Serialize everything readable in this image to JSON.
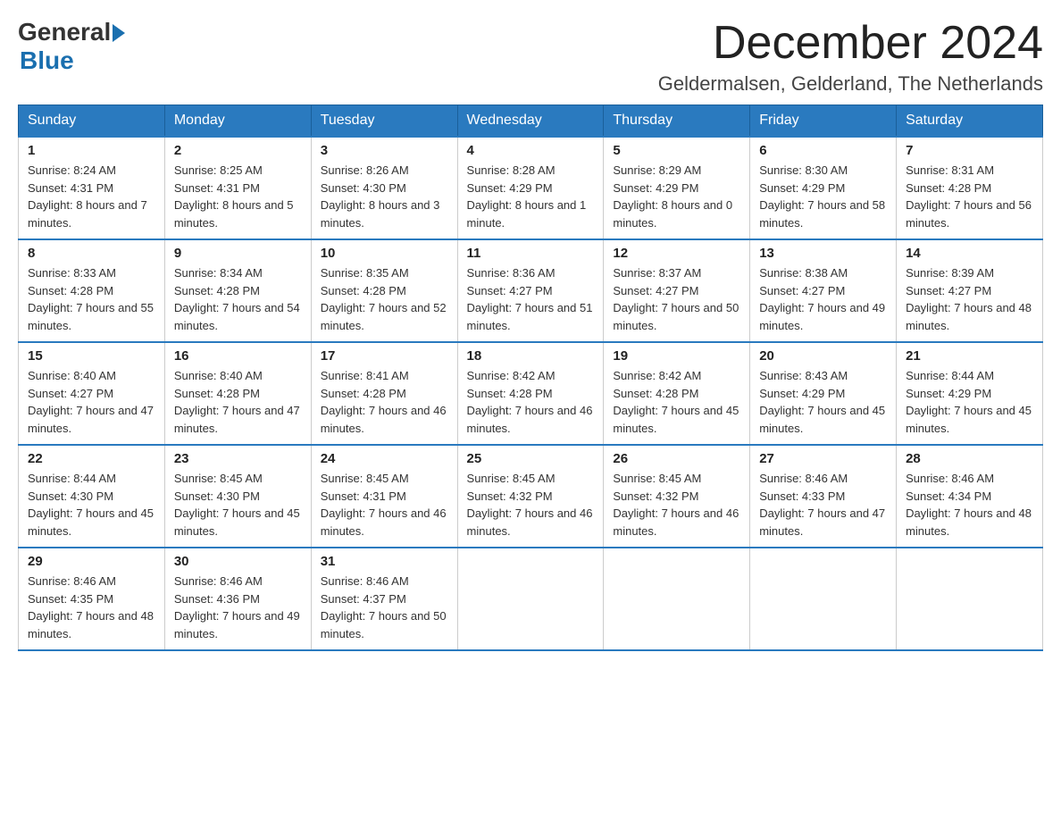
{
  "header": {
    "logo_general": "General",
    "logo_blue": "Blue",
    "month_title": "December 2024",
    "location": "Geldermalsen, Gelderland, The Netherlands"
  },
  "days_of_week": [
    "Sunday",
    "Monday",
    "Tuesday",
    "Wednesday",
    "Thursday",
    "Friday",
    "Saturday"
  ],
  "weeks": [
    [
      {
        "day": "1",
        "sunrise": "8:24 AM",
        "sunset": "4:31 PM",
        "daylight": "8 hours and 7 minutes."
      },
      {
        "day": "2",
        "sunrise": "8:25 AM",
        "sunset": "4:31 PM",
        "daylight": "8 hours and 5 minutes."
      },
      {
        "day": "3",
        "sunrise": "8:26 AM",
        "sunset": "4:30 PM",
        "daylight": "8 hours and 3 minutes."
      },
      {
        "day": "4",
        "sunrise": "8:28 AM",
        "sunset": "4:29 PM",
        "daylight": "8 hours and 1 minute."
      },
      {
        "day": "5",
        "sunrise": "8:29 AM",
        "sunset": "4:29 PM",
        "daylight": "8 hours and 0 minutes."
      },
      {
        "day": "6",
        "sunrise": "8:30 AM",
        "sunset": "4:29 PM",
        "daylight": "7 hours and 58 minutes."
      },
      {
        "day": "7",
        "sunrise": "8:31 AM",
        "sunset": "4:28 PM",
        "daylight": "7 hours and 56 minutes."
      }
    ],
    [
      {
        "day": "8",
        "sunrise": "8:33 AM",
        "sunset": "4:28 PM",
        "daylight": "7 hours and 55 minutes."
      },
      {
        "day": "9",
        "sunrise": "8:34 AM",
        "sunset": "4:28 PM",
        "daylight": "7 hours and 54 minutes."
      },
      {
        "day": "10",
        "sunrise": "8:35 AM",
        "sunset": "4:28 PM",
        "daylight": "7 hours and 52 minutes."
      },
      {
        "day": "11",
        "sunrise": "8:36 AM",
        "sunset": "4:27 PM",
        "daylight": "7 hours and 51 minutes."
      },
      {
        "day": "12",
        "sunrise": "8:37 AM",
        "sunset": "4:27 PM",
        "daylight": "7 hours and 50 minutes."
      },
      {
        "day": "13",
        "sunrise": "8:38 AM",
        "sunset": "4:27 PM",
        "daylight": "7 hours and 49 minutes."
      },
      {
        "day": "14",
        "sunrise": "8:39 AM",
        "sunset": "4:27 PM",
        "daylight": "7 hours and 48 minutes."
      }
    ],
    [
      {
        "day": "15",
        "sunrise": "8:40 AM",
        "sunset": "4:27 PM",
        "daylight": "7 hours and 47 minutes."
      },
      {
        "day": "16",
        "sunrise": "8:40 AM",
        "sunset": "4:28 PM",
        "daylight": "7 hours and 47 minutes."
      },
      {
        "day": "17",
        "sunrise": "8:41 AM",
        "sunset": "4:28 PM",
        "daylight": "7 hours and 46 minutes."
      },
      {
        "day": "18",
        "sunrise": "8:42 AM",
        "sunset": "4:28 PM",
        "daylight": "7 hours and 46 minutes."
      },
      {
        "day": "19",
        "sunrise": "8:42 AM",
        "sunset": "4:28 PM",
        "daylight": "7 hours and 45 minutes."
      },
      {
        "day": "20",
        "sunrise": "8:43 AM",
        "sunset": "4:29 PM",
        "daylight": "7 hours and 45 minutes."
      },
      {
        "day": "21",
        "sunrise": "8:44 AM",
        "sunset": "4:29 PM",
        "daylight": "7 hours and 45 minutes."
      }
    ],
    [
      {
        "day": "22",
        "sunrise": "8:44 AM",
        "sunset": "4:30 PM",
        "daylight": "7 hours and 45 minutes."
      },
      {
        "day": "23",
        "sunrise": "8:45 AM",
        "sunset": "4:30 PM",
        "daylight": "7 hours and 45 minutes."
      },
      {
        "day": "24",
        "sunrise": "8:45 AM",
        "sunset": "4:31 PM",
        "daylight": "7 hours and 46 minutes."
      },
      {
        "day": "25",
        "sunrise": "8:45 AM",
        "sunset": "4:32 PM",
        "daylight": "7 hours and 46 minutes."
      },
      {
        "day": "26",
        "sunrise": "8:45 AM",
        "sunset": "4:32 PM",
        "daylight": "7 hours and 46 minutes."
      },
      {
        "day": "27",
        "sunrise": "8:46 AM",
        "sunset": "4:33 PM",
        "daylight": "7 hours and 47 minutes."
      },
      {
        "day": "28",
        "sunrise": "8:46 AM",
        "sunset": "4:34 PM",
        "daylight": "7 hours and 48 minutes."
      }
    ],
    [
      {
        "day": "29",
        "sunrise": "8:46 AM",
        "sunset": "4:35 PM",
        "daylight": "7 hours and 48 minutes."
      },
      {
        "day": "30",
        "sunrise": "8:46 AM",
        "sunset": "4:36 PM",
        "daylight": "7 hours and 49 minutes."
      },
      {
        "day": "31",
        "sunrise": "8:46 AM",
        "sunset": "4:37 PM",
        "daylight": "7 hours and 50 minutes."
      },
      null,
      null,
      null,
      null
    ]
  ]
}
